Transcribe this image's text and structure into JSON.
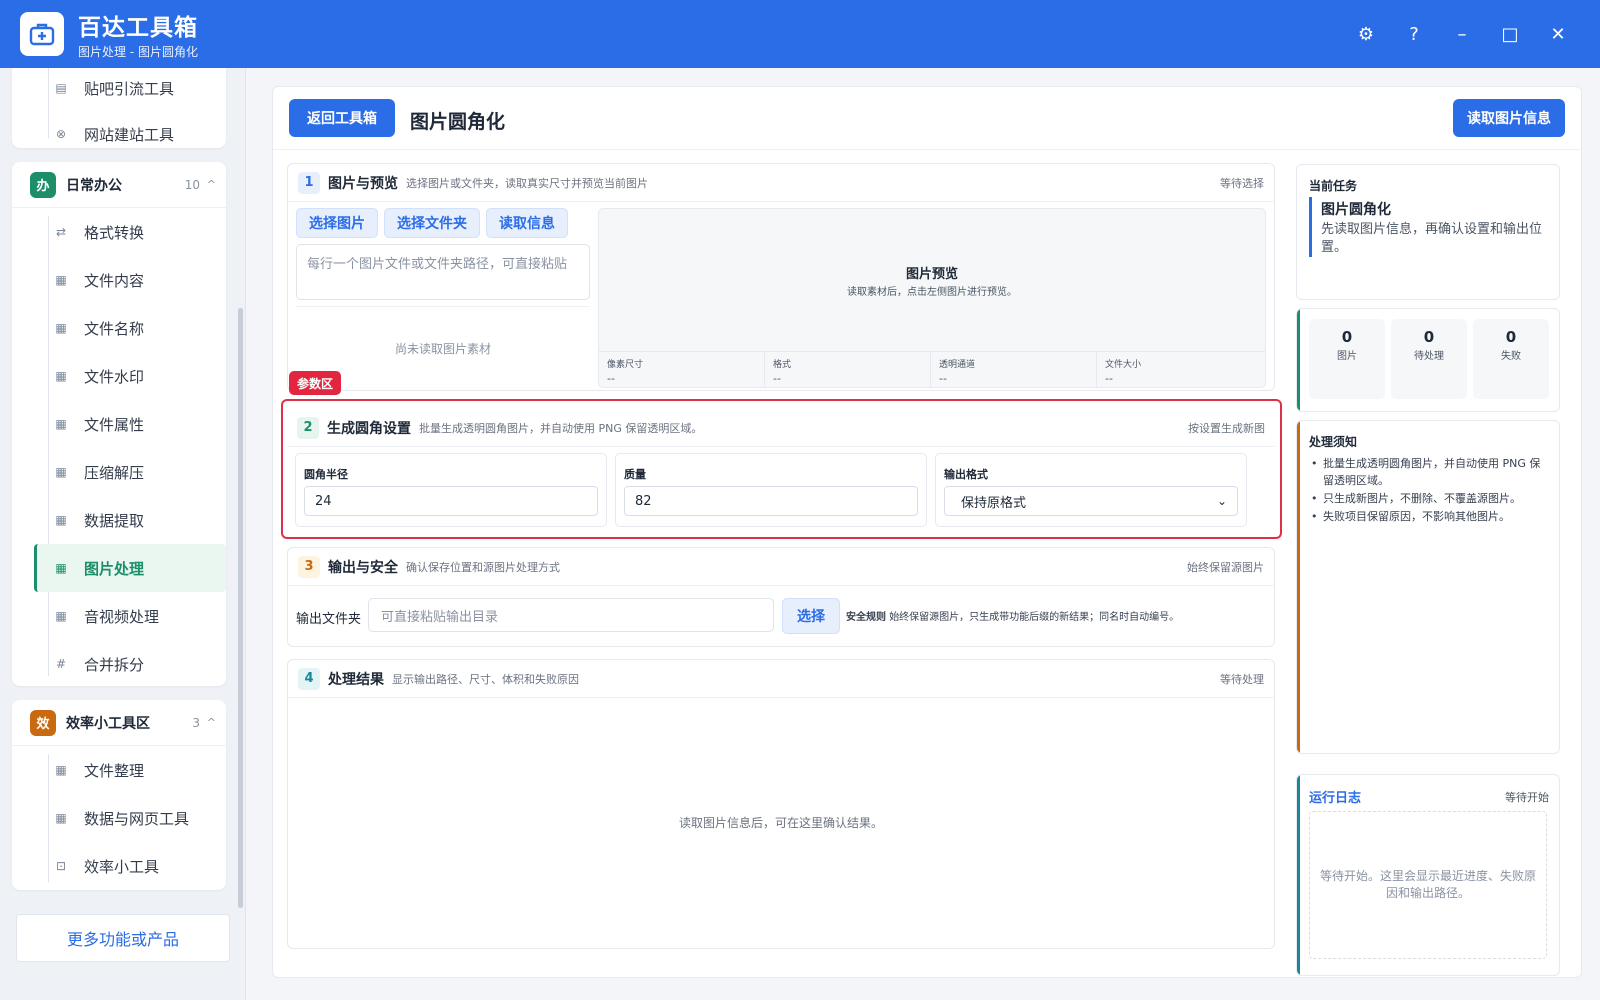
{
  "app": {
    "title": "百达工具箱",
    "subtitle": "图片处理 - 图片圆角化"
  },
  "window_controls": {
    "settings": "⚙",
    "help": "?",
    "minimize": "–",
    "maximize": "□",
    "close": "✕"
  },
  "sidebar": {
    "prev_group": {
      "items": [
        {
          "label": "贴吧引流工具",
          "icon": "document-icon"
        },
        {
          "label": "网站建站工具",
          "icon": "globe-icon"
        }
      ]
    },
    "office_group": {
      "badge": "办",
      "name": "日常办公",
      "count": "10",
      "caret": "^",
      "color": "#1c8f6a",
      "items": [
        {
          "label": "格式转换",
          "icon": "swap-icon"
        },
        {
          "label": "文件内容",
          "icon": "grid-icon"
        },
        {
          "label": "文件名称",
          "icon": "grid-icon"
        },
        {
          "label": "文件水印",
          "icon": "grid-icon"
        },
        {
          "label": "文件属性",
          "icon": "grid-icon"
        },
        {
          "label": "压缩解压",
          "icon": "grid-icon"
        },
        {
          "label": "数据提取",
          "icon": "grid-icon"
        },
        {
          "label": "图片处理",
          "icon": "grid-icon",
          "active": true
        },
        {
          "label": "音视频处理",
          "icon": "grid-icon"
        },
        {
          "label": "合并拆分",
          "icon": "hash-icon"
        }
      ]
    },
    "efficiency_group": {
      "badge": "效",
      "name": "效率小工具区",
      "count": "3",
      "caret": "^",
      "color": "#c96a10",
      "items": [
        {
          "label": "文件整理",
          "icon": "grid-icon"
        },
        {
          "label": "数据与网页工具",
          "icon": "grid-icon"
        },
        {
          "label": "效率小工具",
          "icon": "toolbox-icon"
        }
      ]
    },
    "more_label": "更多功能或产品"
  },
  "main": {
    "back_label": "返回工具箱",
    "title": "图片圆角化",
    "read_info_label": "读取图片信息",
    "section1": {
      "num": "1",
      "title": "图片与预览",
      "desc": "选择图片或文件夹，读取真实尺寸并预览当前图片",
      "status": "等待选择",
      "btn_select_image": "选择图片",
      "btn_select_folder": "选择文件夹",
      "btn_read_info": "读取信息",
      "path_placeholder": "每行一个图片文件或文件夹路径，可直接粘贴",
      "empty_text": "尚未读取图片素材",
      "preview_title": "图片预览",
      "preview_hint": "读取素材后，点击左侧图片进行预览。",
      "meta": [
        {
          "label": "像素尺寸",
          "value": "--"
        },
        {
          "label": "格式",
          "value": "--"
        },
        {
          "label": "透明通道",
          "value": "--"
        },
        {
          "label": "文件大小",
          "value": "--"
        }
      ]
    },
    "param_tag": "参数区",
    "section2": {
      "num": "2",
      "title": "生成圆角设置",
      "desc": "批量生成透明圆角图片，并自动使用 PNG 保留透明区域。",
      "status": "按设置生成新图",
      "radius_label": "圆角半径",
      "radius_value": "24",
      "quality_label": "质量",
      "quality_value": "82",
      "format_label": "输出格式",
      "format_value": "保持原格式"
    },
    "section3": {
      "num": "3",
      "title": "输出与安全",
      "desc": "确认保存位置和源图片处理方式",
      "status": "始终保留源图片",
      "output_label": "输出文件夹",
      "output_placeholder": "可直接粘贴输出目录",
      "select_label": "选择",
      "rule_title": "安全规则",
      "rule_text": "始终保留源图片，只生成带功能后缀的新结果；同名时自动编号。"
    },
    "section4": {
      "num": "4",
      "title": "处理结果",
      "desc": "显示输出路径、尺寸、体积和失败原因",
      "status": "等待处理",
      "empty_text": "读取图片信息后，可在这里确认结果。"
    }
  },
  "right": {
    "task": {
      "label": "当前任务",
      "name": "图片圆角化",
      "desc": "先读取图片信息，再确认设置和输出位置。"
    },
    "stats": [
      {
        "num": "0",
        "label": "图片"
      },
      {
        "num": "0",
        "label": "待处理"
      },
      {
        "num": "0",
        "label": "失败"
      }
    ],
    "notes": {
      "title": "处理须知",
      "items": [
        "批量生成透明圆角图片，并自动使用 PNG 保留透明区域。",
        "只生成新图片，不删除、不覆盖源图片。",
        "失败项目保留原因，不影响其他图片。"
      ]
    },
    "log": {
      "title": "运行日志",
      "status": "等待开始",
      "placeholder": "等待开始。这里会显示最近进度、失败原因和输出路径。"
    }
  },
  "colors": {
    "brand": "#2b6de6",
    "highlight_red": "#e3263f",
    "office_green": "#1c8f6a",
    "efficiency_orange": "#c96a10"
  }
}
